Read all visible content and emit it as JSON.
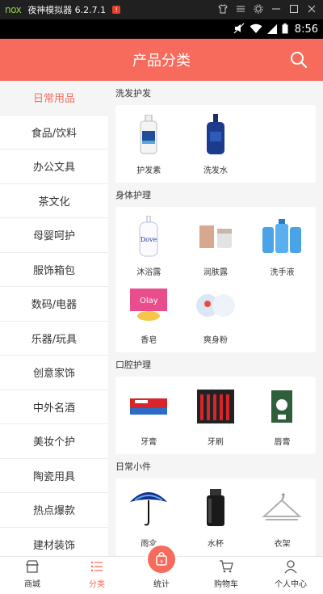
{
  "emulator": {
    "logo": "nox",
    "title": "夜神模拟器 6.2.7.1",
    "badge": "!"
  },
  "status": {
    "time": "8:56"
  },
  "header": {
    "title": "产品分类"
  },
  "sidebar": {
    "items": [
      {
        "label": "日常用品",
        "active": true
      },
      {
        "label": "食品/饮料"
      },
      {
        "label": "办公文具"
      },
      {
        "label": "茶文化"
      },
      {
        "label": "母婴呵护"
      },
      {
        "label": "服饰箱包"
      },
      {
        "label": "数码/电器"
      },
      {
        "label": "乐器/玩具"
      },
      {
        "label": "创意家饰"
      },
      {
        "label": "中外名酒"
      },
      {
        "label": "美妆个护"
      },
      {
        "label": "陶瓷用具"
      },
      {
        "label": "热点爆款"
      },
      {
        "label": "建材装饰"
      }
    ]
  },
  "sections": [
    {
      "title": "洗发护发",
      "products": [
        {
          "label": "护发素",
          "icon": "conditioner-bottle"
        },
        {
          "label": "洗发水",
          "icon": "shampoo-bottle"
        }
      ]
    },
    {
      "title": "身体护理",
      "products": [
        {
          "label": "沐浴露",
          "icon": "body-wash-bottle"
        },
        {
          "label": "润肤露",
          "icon": "lotion-jar"
        },
        {
          "label": "洗手液",
          "icon": "hand-soap-bottles"
        },
        {
          "label": "香皂",
          "icon": "soap-box"
        },
        {
          "label": "爽身粉",
          "icon": "powder-tins"
        }
      ]
    },
    {
      "title": "口腔护理",
      "products": [
        {
          "label": "牙膏",
          "icon": "toothpaste"
        },
        {
          "label": "牙刷",
          "icon": "toothbrush-pack"
        },
        {
          "label": "唇膏",
          "icon": "lip-balm"
        }
      ]
    },
    {
      "title": "日常小件",
      "products": [
        {
          "label": "雨伞",
          "icon": "umbrella"
        },
        {
          "label": "水杯",
          "icon": "thermos"
        },
        {
          "label": "衣架",
          "icon": "hanger"
        }
      ]
    }
  ],
  "tabs": [
    {
      "label": "商城",
      "icon": "shop-icon"
    },
    {
      "label": "分类",
      "icon": "list-icon",
      "active": true
    },
    {
      "label": "统计",
      "icon": "bag-icon"
    },
    {
      "label": "购物车",
      "icon": "cart-icon"
    },
    {
      "label": "个人中心",
      "icon": "person-icon"
    }
  ],
  "colors": {
    "accent": "#f76b5c",
    "background": "#f5f5f5"
  }
}
